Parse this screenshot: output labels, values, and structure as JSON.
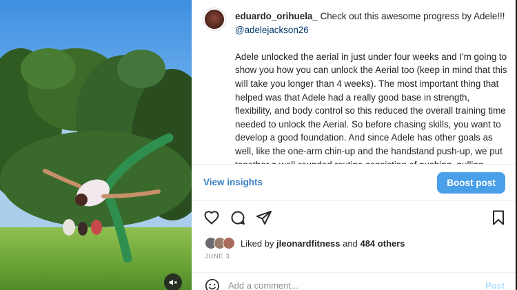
{
  "post": {
    "username": "eduardo_orihuela_",
    "caption_intro": "Check out this awesome progress by Adele!!!",
    "mention": "@adelejackson26",
    "caption_body": "Adele unlocked the aerial in just under four weeks and I'm going to show you how you can unlock the Aerial too (keep in mind that this will take you longer than 4 weeks). The most important thing that helped was that Adele had a really good base in strength, flexibility, and body control so this reduced the overall training time needed to unlock the Aerial. So before chasing skills, you want to develop a good foundation. And since Adele has other goals as well, like the one-arm chin-up and the handstand push-up, we put together a well-rounded routine consisting of pushing, pulling, squatting, hip hinging, core, and overall mobility."
  },
  "insights": {
    "view_label": "View insights",
    "boost_label": "Boost post"
  },
  "actions": {
    "icons": [
      "heart-icon",
      "comment-icon",
      "share-icon",
      "bookmark-icon"
    ]
  },
  "likes": {
    "prefix": "Liked by",
    "user": "jleonardfitness",
    "and": "and",
    "others": "484 others"
  },
  "date": "JUNE 3",
  "comment": {
    "placeholder": "Add a comment...",
    "post_label": "Post"
  },
  "colors": {
    "link": "#3b82c4",
    "boost": "#4a9fe9",
    "post_disabled": "#b2dffc"
  }
}
